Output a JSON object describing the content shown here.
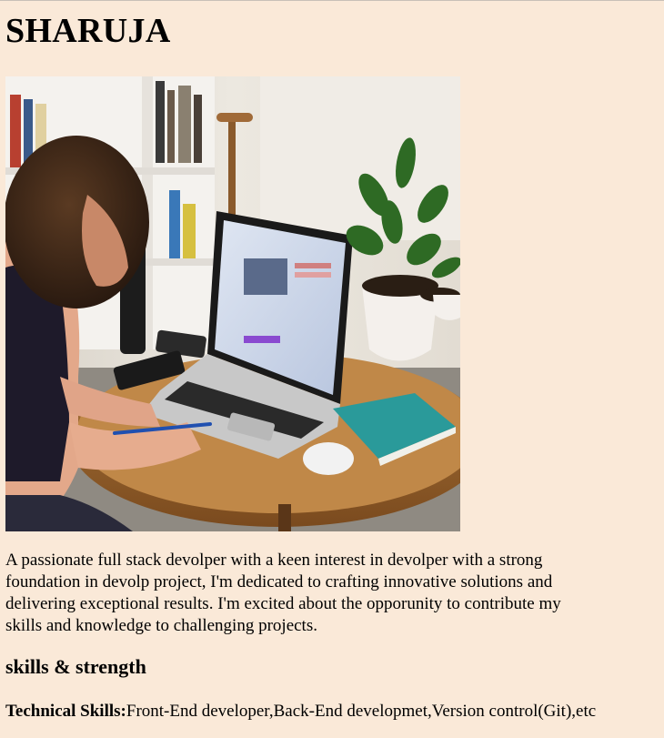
{
  "profile": {
    "name": "SHARUJA",
    "bio": "A passionate full stack devolper with a keen interest in devolper with a strong foundation in devolp project, I'm dedicated to crafting innovative solutions and delivering exceptional results. I'm excited about the opporunity to contribute my skills and knowledge to challenging projects."
  },
  "skills_section": {
    "heading": "skills & strength",
    "technical_label": "Technical Skills:",
    "technical_value": "Front-End developer,Back-End developmet,Version control(Git),etc"
  },
  "colors": {
    "page_background": "#fae9d8",
    "text": "#000000"
  }
}
